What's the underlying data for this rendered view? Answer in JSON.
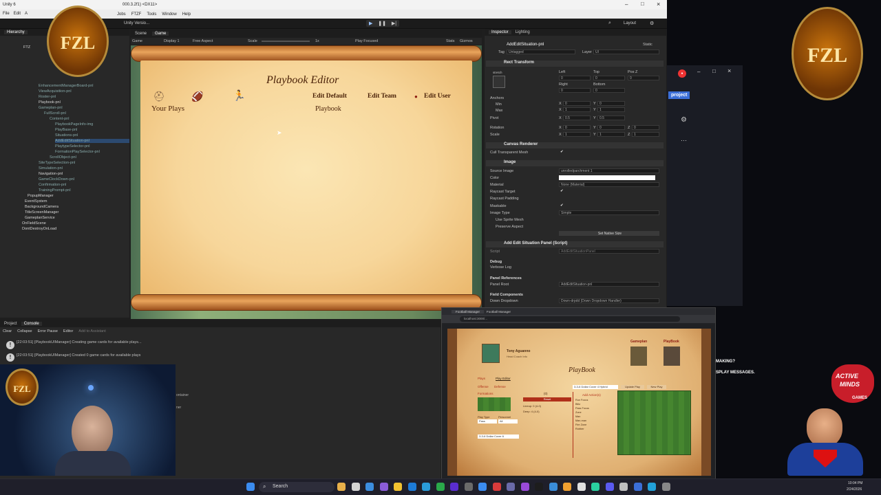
{
  "unity": {
    "title": "Unity 6",
    "title_suffix": "000.3.2f1) <DX11>",
    "menu": [
      "Jobs",
      "FTZF",
      "Tools",
      "Window",
      "Help"
    ],
    "left_menu": [
      "File",
      "Edit",
      "A"
    ],
    "toolbar_account": "Unity Versio...",
    "layout_label": "Layout",
    "tabs_top": [
      "Scene",
      "Game"
    ],
    "game_bar": {
      "mode": "Game",
      "display": "Display 1",
      "aspect": "Free Aspect",
      "scale_label": "Scale",
      "scale_value": "1x",
      "play_focused": "Play Focused",
      "stats": "Stats",
      "gizmos": "Gizmos"
    },
    "hierarchy_tab": "Hierarchy",
    "hierarchy": [
      {
        "label": "EnhancementManagerBoard-pnl",
        "white": false
      },
      {
        "label": "ViewAcquisition-pnl",
        "white": false
      },
      {
        "label": "Roster-pnl",
        "white": false
      },
      {
        "label": "Playbook-pnl",
        "white": true
      },
      {
        "label": "Gameplan-pnl",
        "white": false
      },
      {
        "label": "FullScroll-pnl",
        "white": false
      },
      {
        "label": "Content-pnl",
        "white": false
      },
      {
        "label": "PlaybookPageInfo-img",
        "white": false
      },
      {
        "label": "PlayBase-pnl",
        "white": false
      },
      {
        "label": "Situations-pnl",
        "white": false
      },
      {
        "label": "AddEditSituation-pnl",
        "white": false
      },
      {
        "label": "PlaytypeSelector-pnl",
        "white": false
      },
      {
        "label": "FormationPlaySelector-pnl",
        "white": false
      },
      {
        "label": "ScrollObject-pnl",
        "white": false
      },
      {
        "label": "SiteTypeSelection-pnl",
        "white": false
      },
      {
        "label": "Simulation-pnl",
        "white": false
      },
      {
        "label": "Navigation-pnl",
        "white": true
      },
      {
        "label": "GameClockDown-pnl",
        "white": false
      },
      {
        "label": "Confirmation-pnl",
        "white": false
      },
      {
        "label": "TrainingPrompt-pnl",
        "white": false
      },
      {
        "label": "PopupManager",
        "white": true
      },
      {
        "label": "EventSystem",
        "white": true
      },
      {
        "label": "BackgroundCamera",
        "white": true
      },
      {
        "label": "TitleScreenManager",
        "white": true
      },
      {
        "label": "GameplanService",
        "white": true
      },
      {
        "label": "OnFieldScene",
        "white": true
      },
      {
        "label": "DontDestroyOnLoad",
        "white": true
      }
    ],
    "hierarchy_root": "FTZ",
    "inspector_tabs": [
      "Inspector",
      "Lighting"
    ],
    "inspector": {
      "object_name": "AddEditSituation-pnl",
      "static_label": "Static",
      "tag_label": "Tag",
      "tag_value": "Untagged",
      "layer_label": "Layer",
      "layer_value": "UI",
      "rect_transform": "Rect Transform",
      "stretch": "stretch",
      "left": "Left",
      "top": "Top",
      "posz": "Pos Z",
      "left_v": "0",
      "top_v": "0",
      "posz_v": "0",
      "right": "Right",
      "bottom": "Bottom",
      "right_v": "0",
      "bottom_v": "0",
      "anchors": "Anchors",
      "min": "Min",
      "max": "Max",
      "pivot": "Pivot",
      "rotation": "Rotation",
      "scale": "Scale",
      "x_lbl": "X",
      "y_lbl": "Y",
      "z_lbl": "Z",
      "min_x": "0",
      "min_y": "0",
      "max_x": "1",
      "max_y": "1",
      "pivot_x": "0.5",
      "pivot_y": "0.5",
      "rot_x": "0",
      "rot_y": "0",
      "rot_z": "0",
      "scale_x": "1",
      "scale_y": "1",
      "scale_z": "1",
      "canvas_renderer": "Canvas Renderer",
      "cull": "Cull Transparent Mesh",
      "image": "Image",
      "source_image": "Source Image",
      "source_value": "unrolledparchment 1",
      "color": "Color",
      "material": "Material",
      "material_value": "None (Material)",
      "raycast_target": "Raycast Target",
      "raycast_padding": "Raycast Padding",
      "maskable": "Maskable",
      "image_type": "Image Type",
      "image_type_value": "Simple",
      "use_sprite_mesh": "Use Sprite Mesh",
      "preserve_aspect": "Preserve Aspect",
      "set_native": "Set Native Size",
      "script_comp": "Add Edit Situation Panel (Script)",
      "script": "Script",
      "script_value": "AddEditSituationPanel",
      "debug": "Debug",
      "verbose": "Verbose Log",
      "panel_refs": "Panel References",
      "panel_root": "Panel Root",
      "panel_root_value": "AddEditSituation-pnl",
      "field_components": "Field Components",
      "down_dropdown": "Down Dropdown",
      "down_dropdown_value": "Down-drpdd (Down Dropdown Handler)"
    },
    "console_tabs": [
      "Project",
      "Console"
    ],
    "console_toolbar": [
      "Clear",
      "Collapse",
      "Error Pause",
      "Editor"
    ],
    "console_ai": "Add to Assistant",
    "console": [
      "[22:03:51] [PlaybookUIManager] Creating game cards for available plays...",
      "[22:03:51] [PlaybookUIManager] Created 0 game cards for available plays"
    ],
    "side_labels": [
      "ontainer",
      "ner"
    ]
  },
  "game": {
    "title": "Playbook Editor",
    "your_plays": "Your Plays",
    "edit_default": "Edit Default",
    "edit_default_2": "Playbook",
    "edit_team": "Edit Team",
    "edit_user": "Edit User"
  },
  "browser": {
    "tab1": "Football Manager",
    "tab2": "Football Manager",
    "url": "localhost:3000/...",
    "user_name": "Tony Aguanno",
    "user_sub": "Head Coach Info",
    "playbook_title": "PlayBook",
    "gameplan_label": "Gameplan",
    "playbook_label": "PlayBook",
    "tabs": [
      "Plays",
      "Play Editor"
    ],
    "offense": "Offense",
    "defense": "Defense",
    "formations": "Formations",
    "play_type": "Play Type",
    "personnel": "Personnel",
    "play_type_value": "Pass",
    "personnel_value": "All",
    "play_name_value": "3-3-6 Dollar Cover 6",
    "dropdown_value": "3-3-6 Dollar Cover 4 Hybrid",
    "update_play": "Update Play",
    "new_play": "New Play",
    "add_actions": "Add Action(s)",
    "mid_header": "(0)",
    "mid_btn": "Reset",
    "mid_lines": [
      "Lineup: 0 (4-0)",
      "Deep: 4 (4-0)"
    ],
    "actions": [
      "Run Focus",
      "Blitz",
      "Pass Focus",
      "Zone",
      "Man",
      "Man-man",
      "Fire Zone",
      "Robber"
    ]
  },
  "overlay": {
    "right_button": "project",
    "snippet1": "MAKING?",
    "snippet2": "SPLAY MESSAGES.",
    "active_minds_1": "ACTIVE",
    "active_minds_2": "MINDS",
    "active_minds_3": "GAMES",
    "logo": "FZL"
  },
  "taskbar": {
    "search": "Search",
    "time": "10:04 PM",
    "date": "2/24/2026"
  },
  "colors": {
    "unity_bg": "#1e1e1e",
    "parchment": "#f7d69a",
    "ink": "#4b2208",
    "accent_blue": "#3b6fd8"
  }
}
